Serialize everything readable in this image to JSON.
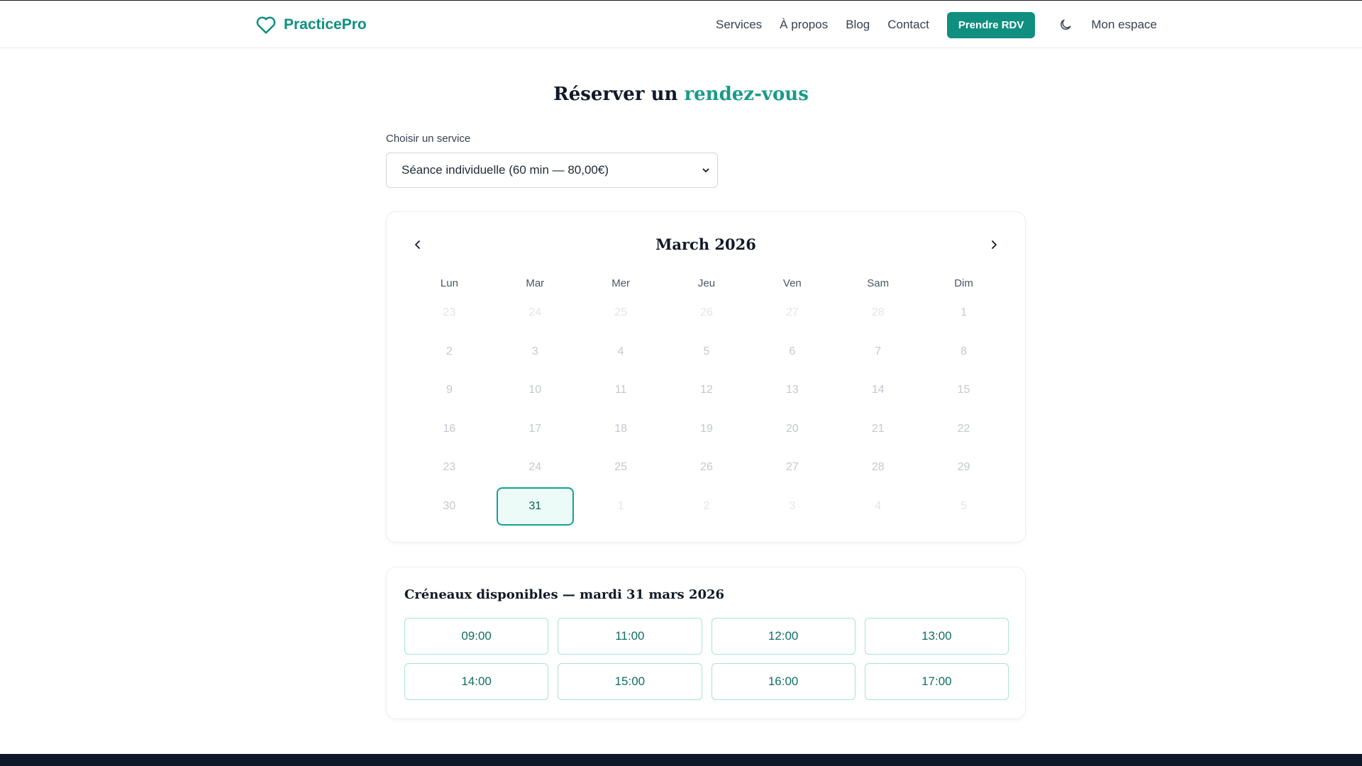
{
  "brand": {
    "name": "PracticePro",
    "icon": "heart-icon",
    "color": "#0f8f7f"
  },
  "nav": {
    "links": [
      "Services",
      "À propos",
      "Blog",
      "Contact"
    ],
    "cta": "Prendre RDV",
    "theme_icon": "moon-icon",
    "account": "Mon espace"
  },
  "page": {
    "title_main": "Réserver un",
    "title_accent": "rendez-vous"
  },
  "service": {
    "label": "Choisir un service",
    "selected": "Séance individuelle (60 min — 80,00€)"
  },
  "calendar": {
    "month": "March 2026",
    "weekdays": [
      "Lun",
      "Mar",
      "Mer",
      "Jeu",
      "Ven",
      "Sam",
      "Dim"
    ],
    "weeks": [
      [
        {
          "d": "23",
          "s": "other"
        },
        {
          "d": "24",
          "s": "other"
        },
        {
          "d": "25",
          "s": "other"
        },
        {
          "d": "26",
          "s": "other"
        },
        {
          "d": "27",
          "s": "other"
        },
        {
          "d": "28",
          "s": "other"
        },
        {
          "d": "1",
          "s": "past"
        }
      ],
      [
        {
          "d": "2",
          "s": "past"
        },
        {
          "d": "3",
          "s": "past"
        },
        {
          "d": "4",
          "s": "past"
        },
        {
          "d": "5",
          "s": "past"
        },
        {
          "d": "6",
          "s": "past"
        },
        {
          "d": "7",
          "s": "past"
        },
        {
          "d": "8",
          "s": "past"
        }
      ],
      [
        {
          "d": "9",
          "s": "past"
        },
        {
          "d": "10",
          "s": "past"
        },
        {
          "d": "11",
          "s": "past"
        },
        {
          "d": "12",
          "s": "past"
        },
        {
          "d": "13",
          "s": "past"
        },
        {
          "d": "14",
          "s": "past"
        },
        {
          "d": "15",
          "s": "past"
        }
      ],
      [
        {
          "d": "16",
          "s": "past"
        },
        {
          "d": "17",
          "s": "past"
        },
        {
          "d": "18",
          "s": "past"
        },
        {
          "d": "19",
          "s": "past"
        },
        {
          "d": "20",
          "s": "past"
        },
        {
          "d": "21",
          "s": "past"
        },
        {
          "d": "22",
          "s": "past"
        }
      ],
      [
        {
          "d": "23",
          "s": "past"
        },
        {
          "d": "24",
          "s": "past"
        },
        {
          "d": "25",
          "s": "past"
        },
        {
          "d": "26",
          "s": "past"
        },
        {
          "d": "27",
          "s": "past"
        },
        {
          "d": "28",
          "s": "past"
        },
        {
          "d": "29",
          "s": "past"
        }
      ],
      [
        {
          "d": "30",
          "s": "past"
        },
        {
          "d": "31",
          "s": "selected"
        },
        {
          "d": "1",
          "s": "other"
        },
        {
          "d": "2",
          "s": "other"
        },
        {
          "d": "3",
          "s": "other"
        },
        {
          "d": "4",
          "s": "other"
        },
        {
          "d": "5",
          "s": "other"
        }
      ]
    ]
  },
  "slots": {
    "title": "Créneaux disponibles — mardi 31 mars 2026",
    "times": [
      "09:00",
      "11:00",
      "12:00",
      "13:00",
      "14:00",
      "15:00",
      "16:00",
      "17:00"
    ]
  }
}
